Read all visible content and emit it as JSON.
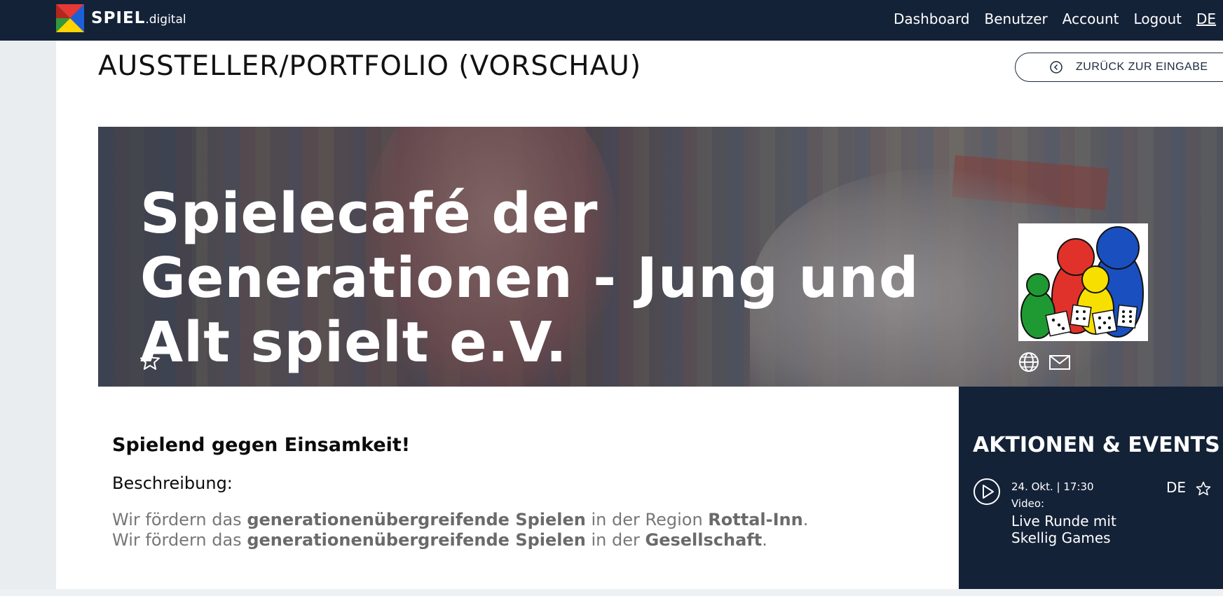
{
  "app": {
    "logo_text": "SPIEL",
    "logo_suffix": ".digital"
  },
  "nav": {
    "items": [
      "Dashboard",
      "Benutzer",
      "Account",
      "Logout"
    ],
    "language": "DE"
  },
  "page": {
    "title": "AUSSTELLER/PORTFOLIO (VORSCHAU)",
    "back_button": "ZURÜCK ZUR EINGABE"
  },
  "hero": {
    "title": "Spielecafé der Generationen - Jung und Alt spielt e.V.",
    "image_icons": [
      "star-icon",
      "globe-icon",
      "mail-icon"
    ]
  },
  "content": {
    "slogan": "Spielend gegen Einsamkeit!",
    "description_label": "Beschreibung:",
    "lines": [
      {
        "pre": "Wir fördern das ",
        "bold1": "generationenübergreifende Spielen",
        "mid": " in der Region ",
        "bold2": "Rottal-Inn",
        "post": "."
      },
      {
        "pre": "Wir fördern das ",
        "bold1": "generationenübergreifende Spielen",
        "mid": " in der ",
        "bold2": "Gesellschaft",
        "post": "."
      }
    ]
  },
  "events": {
    "heading": "AKTIONEN & EVENTS",
    "items": [
      {
        "date": "24. Okt. | 17:30",
        "type": "Video:",
        "title": "Live Runde mit Skellig Games",
        "language": "DE"
      }
    ]
  },
  "colors": {
    "navy": "#142238",
    "white": "#ffffff",
    "muted_text": "#777777"
  }
}
